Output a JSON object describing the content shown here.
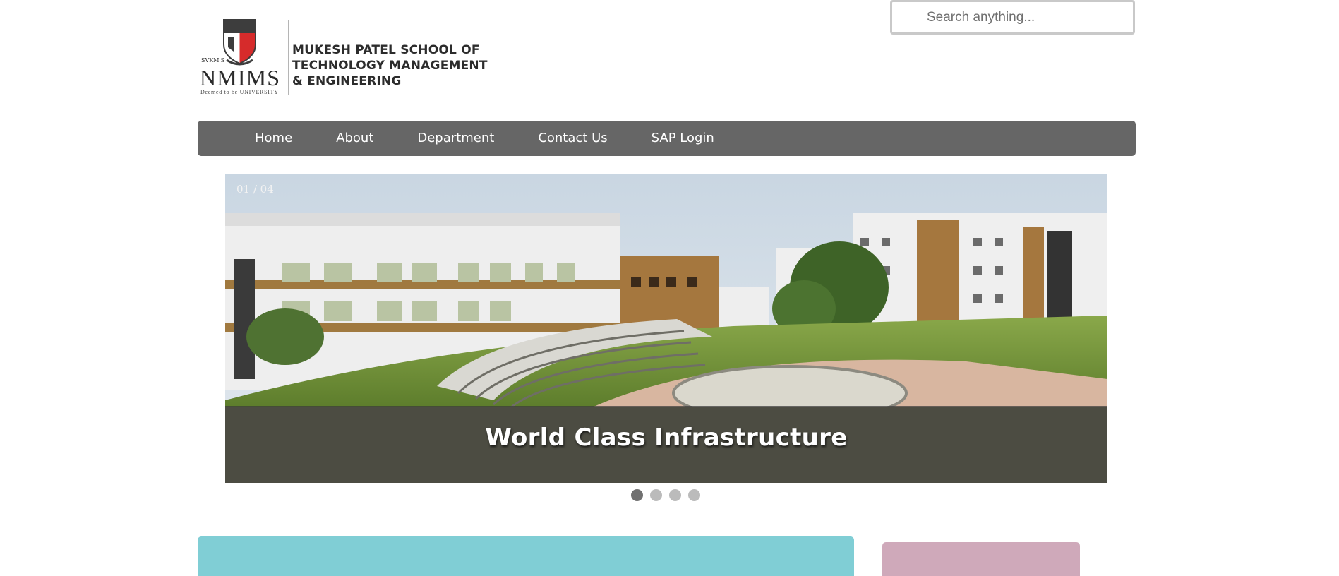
{
  "logo": {
    "seal_text": "SVKM'S",
    "brand": "NMIMS",
    "tagline": "Deemed to be UNIVERSITY",
    "school_name_lines": [
      "MUKESH PATEL SCHOOL OF",
      "TECHNOLOGY MANAGEMENT",
      "& ENGINEERING"
    ]
  },
  "search": {
    "placeholder": "Search anything..."
  },
  "nav": {
    "items": [
      {
        "label": "Home"
      },
      {
        "label": "About"
      },
      {
        "label": "Department"
      },
      {
        "label": "Contact Us"
      },
      {
        "label": "SAP Login"
      }
    ]
  },
  "slideshow": {
    "counter": "01 / 04",
    "caption": "World Class Infrastructure",
    "slide_count": 4,
    "active_index": 0
  },
  "colors": {
    "nav_bg": "#666666",
    "dot_active": "#717171",
    "dot_inactive": "#bbbbbb",
    "panel_teal": "#80ced5",
    "panel_pink": "#cfa9ba",
    "logo_red": "#d62b2b"
  }
}
